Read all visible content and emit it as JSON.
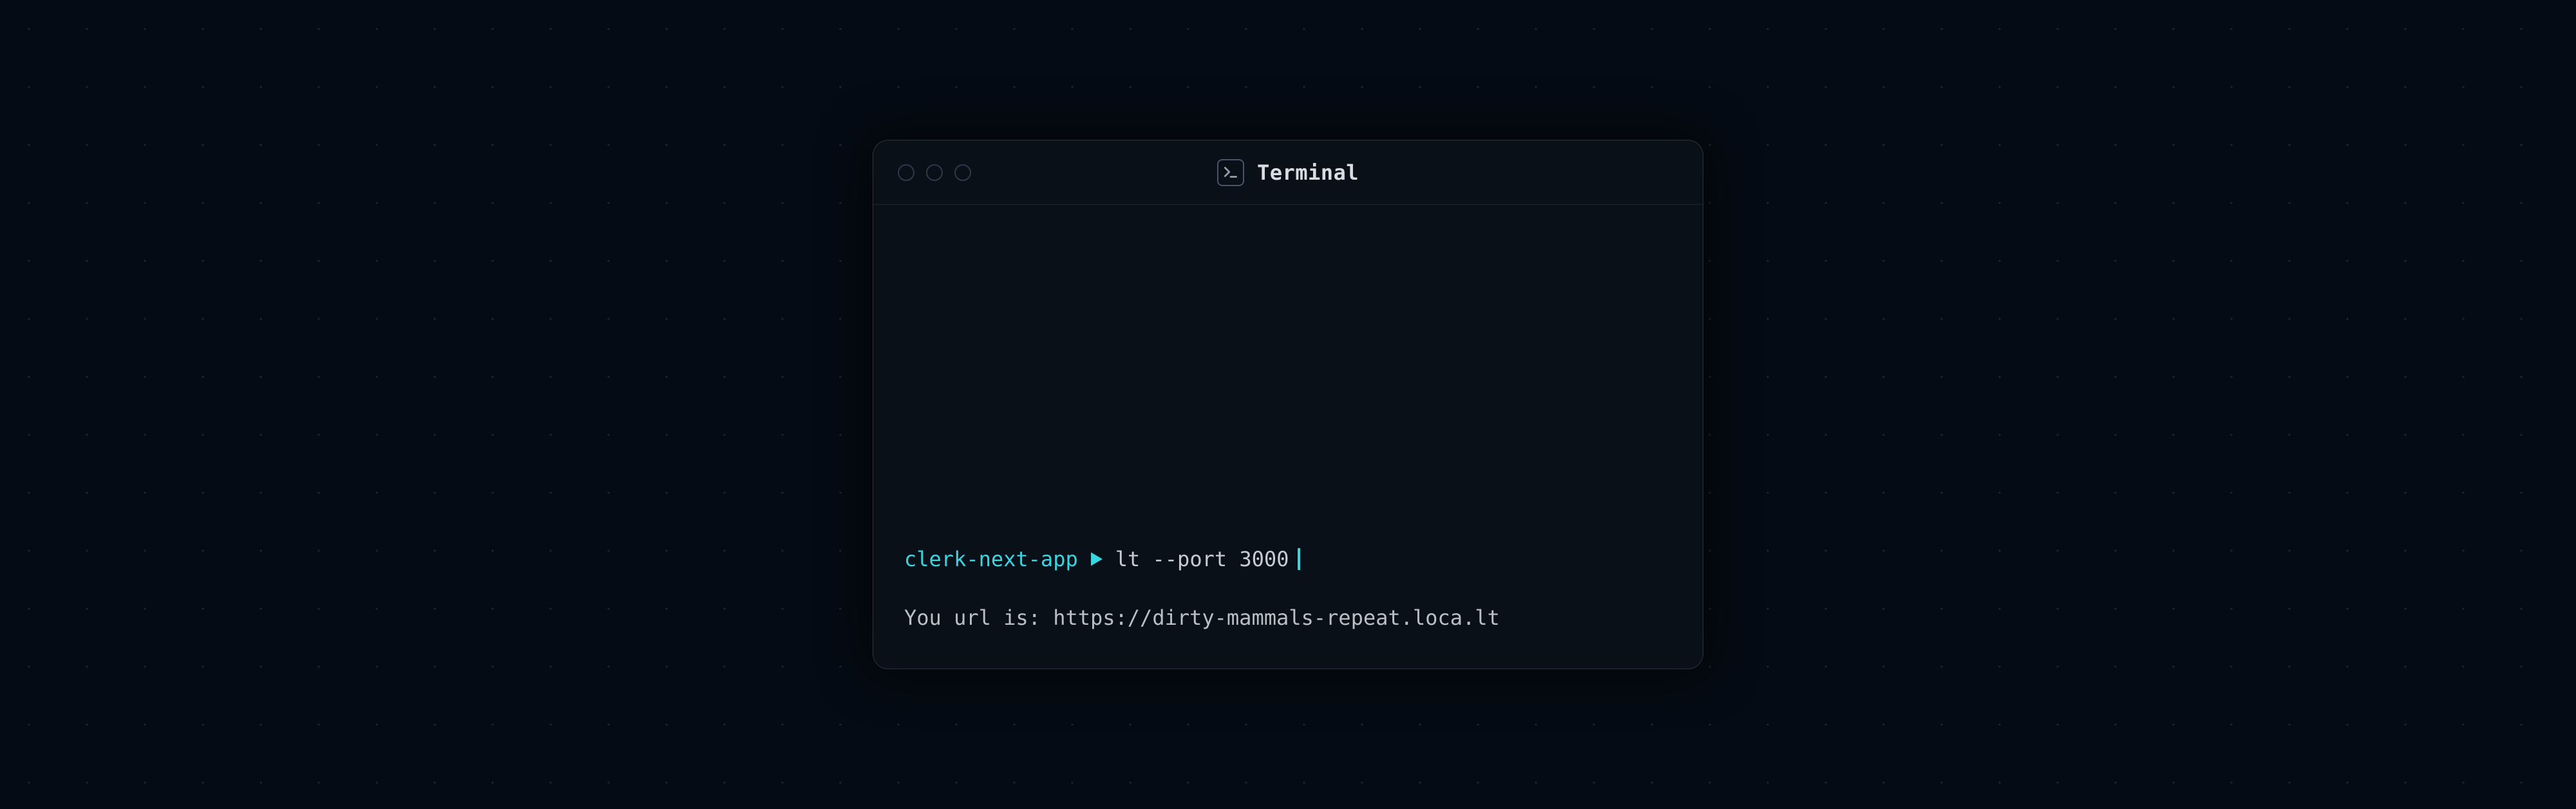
{
  "window": {
    "tab_label": "Terminal"
  },
  "terminal": {
    "prompt_context": "clerk-next-app",
    "command": "lt --port 3000",
    "output_line1": "You url is: https://dirty-mammals-repeat.loca.lt"
  }
}
